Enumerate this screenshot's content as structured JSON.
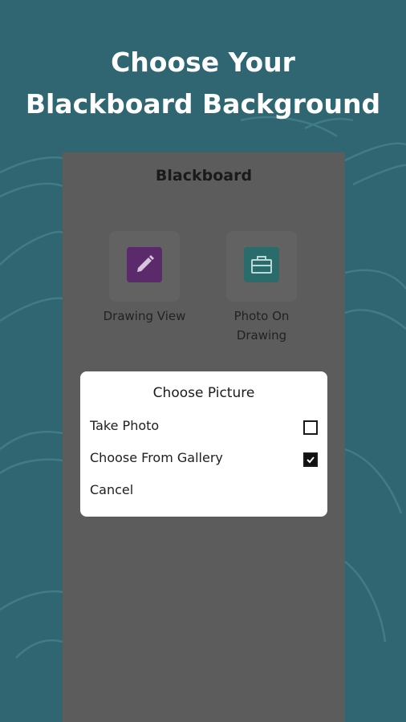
{
  "headline": {
    "line1": "Choose Your",
    "line2": "Blackboard Background"
  },
  "app": {
    "title": "Blackboard",
    "tiles": [
      {
        "label": "Drawing View",
        "icon": "pencil-icon",
        "color": "#5b2a6a"
      },
      {
        "label": "Photo On Drawing",
        "label_line1": "Photo On",
        "label_line2": "Drawing",
        "icon": "briefcase-icon",
        "color": "#2a6b6b"
      }
    ]
  },
  "dialog": {
    "title": "Choose Picture",
    "options": [
      {
        "label": "Take Photo",
        "checked": false
      },
      {
        "label": "Choose From Gallery",
        "checked": true
      },
      {
        "label": "Cancel"
      }
    ]
  },
  "colors": {
    "background": "#2f6672",
    "overlay": "#5c5c5c",
    "dialog": "#ffffff"
  }
}
